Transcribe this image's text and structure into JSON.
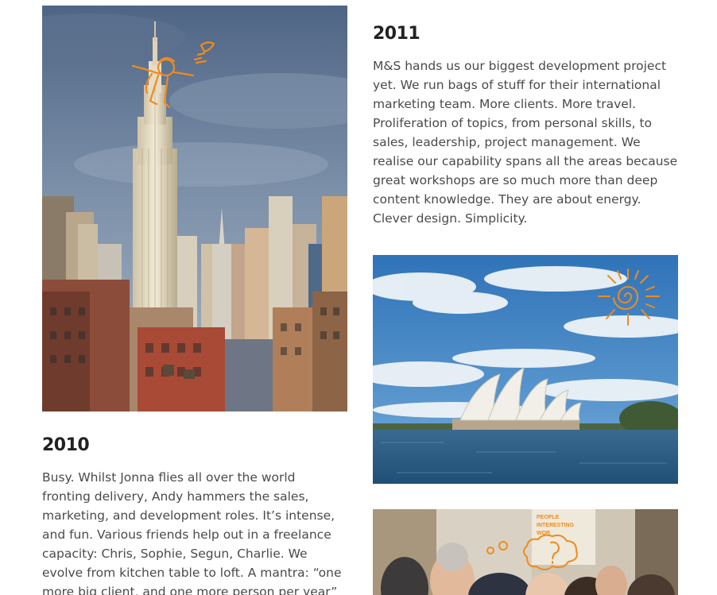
{
  "entries": {
    "y2011": {
      "year": "2011",
      "text": "M&S hands us our biggest development project yet. We run bags of stuff for their international marketing team. More clients. More travel. Proliferation of topics, from personal skills, to sales, leadership, project management. We realise our capability spans all the areas because great workshops are so much more than deep content knowledge. They are about energy. Clever design. Simplicity."
    },
    "y2010": {
      "year": "2010",
      "text": "Busy. Whilst Jonna flies all over the world fronting delivery, Andy hammers the sales, marketing, and development roles. It’s intense, and fun. Various friends help out in a freelance capacity: Chris, Sophie, Segun, Charlie. We evolve from kitchen table to loft. A mantra: “one more big client, and one more person per year” is thrown around. Let’s"
    }
  },
  "images": {
    "new_york": {
      "subject": "Empire State Building skyline with orange doodle figure",
      "doodle_icon": "superhero-doodle-icon"
    },
    "sydney": {
      "subject": "Sydney Opera House under blue sky with orange sun doodle",
      "doodle_icon": "sun-doodle-icon"
    },
    "workshop": {
      "subject": "People at a workshop with orange thought-bubble doodle",
      "doodle_icon": "thought-bubble-icon",
      "sign_lines": [
        "PEOPLE",
        "INTERESTING",
        "WOR"
      ]
    }
  },
  "colors": {
    "doodle_orange": "#f08a1c",
    "heading": "#222222",
    "body": "#4a4a4a"
  }
}
